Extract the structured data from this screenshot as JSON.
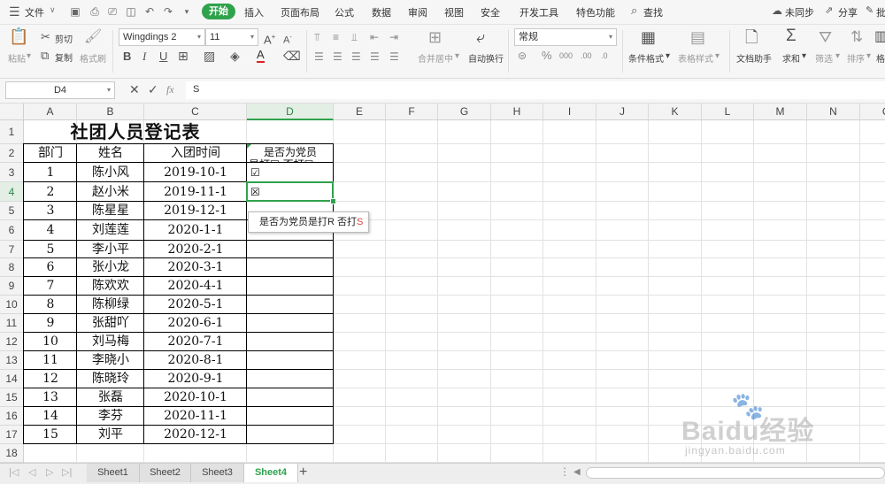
{
  "menubar": {
    "file_label": "文件",
    "tabs": [
      "开始",
      "插入",
      "页面布局",
      "公式",
      "数据",
      "审阅",
      "视图",
      "安全",
      "开发工具",
      "特色功能"
    ],
    "search_label": "查找",
    "sync_label": "未同步",
    "share_label": "分享",
    "comment_label": "批"
  },
  "ribbon": {
    "paste_label": "粘贴",
    "cut_label": "剪切",
    "copy_label": "复制",
    "format_painter_label": "格式刷",
    "font_name": "Wingdings 2",
    "font_size": "11",
    "merge_label": "合并居中",
    "wrap_label": "自动换行",
    "number_format": "常规",
    "cond_format_label": "条件格式",
    "table_style_label": "表格样式",
    "doc_helper_label": "文档助手",
    "sum_label": "求和",
    "filter_label": "筛选",
    "sort_label": "排序",
    "more_label": "格"
  },
  "formula_bar": {
    "cell_ref": "D4",
    "fx_label": "fx",
    "content": "S"
  },
  "columns": [
    "A",
    "B",
    "C",
    "D",
    "E",
    "F",
    "G",
    "H",
    "I",
    "J",
    "K",
    "L",
    "M",
    "N",
    "O"
  ],
  "rows": [
    "1",
    "2",
    "3",
    "4",
    "5",
    "6",
    "7",
    "8",
    "9",
    "10",
    "11",
    "12",
    "13",
    "14",
    "15",
    "16",
    "17",
    "18"
  ],
  "sheet": {
    "title": "社团人员登记表",
    "headers": {
      "dept": "部门",
      "name": "姓名",
      "date": "入团时间",
      "party_line1": "是否为党员",
      "party_line2": "是打☑  否打☒"
    },
    "records": [
      [
        "1",
        "陈小风",
        "2019-10-1",
        "☑"
      ],
      [
        "2",
        "赵小米",
        "2019-11-1",
        "☒"
      ],
      [
        "3",
        "陈星星",
        "2019-12-1",
        ""
      ],
      [
        "4",
        "刘莲莲",
        "2020-1-1",
        ""
      ],
      [
        "5",
        "李小平",
        "2020-2-1",
        ""
      ],
      [
        "6",
        "张小龙",
        "2020-3-1",
        ""
      ],
      [
        "7",
        "陈欢欢",
        "2020-4-1",
        ""
      ],
      [
        "8",
        "陈柳绿",
        "2020-5-1",
        ""
      ],
      [
        "9",
        "张甜吖",
        "2020-6-1",
        ""
      ],
      [
        "10",
        "刘马梅",
        "2020-7-1",
        ""
      ],
      [
        "11",
        "李晓小",
        "2020-8-1",
        ""
      ],
      [
        "12",
        "陈晓玲",
        "2020-9-1",
        ""
      ],
      [
        "13",
        "张磊",
        "2020-10-1",
        ""
      ],
      [
        "14",
        "李芬",
        "2020-11-1",
        ""
      ],
      [
        "15",
        "刘平",
        "2020-12-1",
        ""
      ]
    ]
  },
  "tooltip": {
    "text": "是否为党员是打R 否打",
    "suffix": "S"
  },
  "sheet_tabs": [
    "Sheet1",
    "Sheet2",
    "Sheet3",
    "Sheet4"
  ],
  "active_sheet": "Sheet4",
  "watermark": {
    "brand": "Baidu经验",
    "url": "jingyan.baidu.com"
  },
  "colors": {
    "accent": "#2fa24c"
  }
}
